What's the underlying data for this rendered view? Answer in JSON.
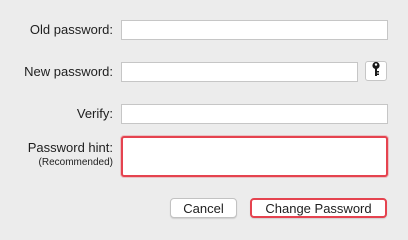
{
  "dialog": {
    "old_password": {
      "label": "Old password:",
      "value": ""
    },
    "new_password": {
      "label": "New password:",
      "value": ""
    },
    "verify": {
      "label": "Verify:",
      "value": ""
    },
    "password_hint": {
      "label": "Password hint:",
      "sublabel": "(Recommended)",
      "value": ""
    },
    "key_button_icon": "key-icon",
    "cancel_label": "Cancel",
    "change_label": "Change Password"
  },
  "colors": {
    "background": "#ececec",
    "focus_ring": "#e5434f",
    "field_border": "#c6c6c6"
  }
}
